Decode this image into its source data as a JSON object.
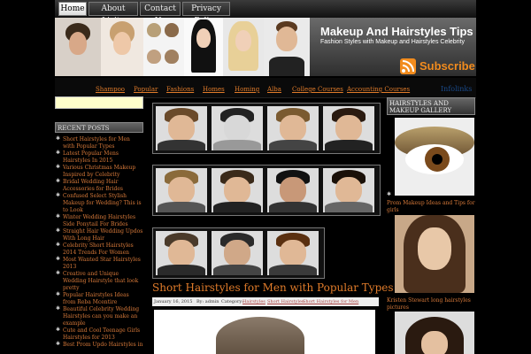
{
  "topnav": [
    "Home",
    "About Livita",
    "Contact Us",
    "Privacy Policy"
  ],
  "header": {
    "title": "Makeup And Hairstyles Tips",
    "tagline": "Fashion Styles with Makeup and Hairstyles Celebrity",
    "subscribe": "Subscribe"
  },
  "categories": [
    "Shampoo",
    "Popular",
    "Fashions",
    "Homes",
    "Homing",
    "Alba",
    "College Courses",
    "Accounting Courses"
  ],
  "rss_link": "Infolinks",
  "sidebar": {
    "recent_heading": "RECENT POSTS",
    "recent_posts": [
      "Short Hairstyles for Men with Popular Types",
      "Latest Popular Mens Hairstyles In 2015",
      "Various Christmas Makeup Inspired by Celebrity",
      "Bridal Wedding Hair Accessories for Brides",
      "Confused Select Stylish Makeup for Wedding? This is to Look",
      "Winter Wedding Hairstyles Side Ponytail For Brides",
      "Straight Hair Wedding Updos With Long Hair",
      "Celebrity Short Hairstyles 2014 Trends For Women",
      "Most Wanted Star Hairstyles 2013",
      "Creative and Unique Wedding Hairstyle that look pretty",
      "Popular Hairstyles Ideas from Reba Mcentire",
      "Beautiful Celebrity Wedding Hairstyles can you make an example",
      "Cute and Cool Teenage Girls Hairstyles for 2013",
      "Best Prom Updo Hairstyles in"
    ]
  },
  "post": {
    "title": "Short Hairstyles for Men with Popular Types",
    "date": "January 16, 2015",
    "by": "By: admin",
    "category_label": "Category:",
    "tags": [
      "Hairstyles",
      "Short Hairstyles",
      "Short Hairstyles for Men"
    ]
  },
  "right_sidebar": {
    "heading": "HAIRSTYLES AND MAKEUP GALLERY",
    "captions": [
      "Prom Makeup Ideas and Tips for girls",
      "Kristen Stewart long hairstyles pictures"
    ]
  },
  "colors": {
    "background": "#000000",
    "link": "#e07b2a",
    "subscribe": "#f28c1e"
  }
}
